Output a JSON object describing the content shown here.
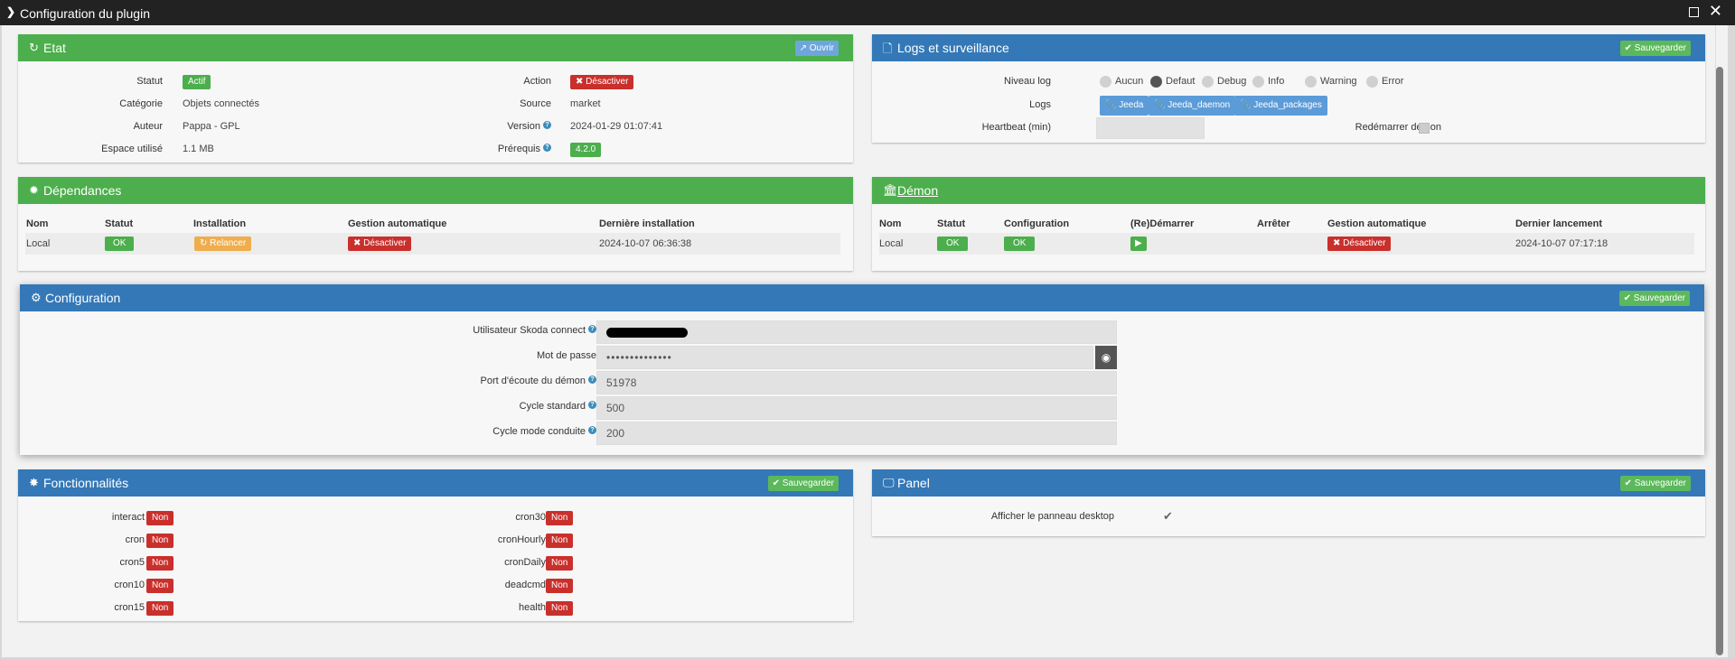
{
  "window": {
    "title": "Configuration du plugin"
  },
  "etat": {
    "title": "Etat",
    "open_btn": "Ouvrir",
    "statut_label": "Statut",
    "statut_value": "Actif",
    "categorie_label": "Catégorie",
    "categorie_value": "Objets connectés",
    "auteur_label": "Auteur",
    "auteur_value": "Pappa - GPL",
    "espace_label": "Espace utilisé",
    "espace_value": "1.1 MB",
    "action_label": "Action",
    "action_btn": "Désactiver",
    "source_label": "Source",
    "source_value": "market",
    "version_label": "Version",
    "version_value": "2024-01-29 01:07:41",
    "prerequis_label": "Prérequis",
    "prerequis_value": "4.2.0"
  },
  "logs": {
    "title": "Logs et surveillance",
    "save_btn": "Sauvegarder",
    "niveau_label": "Niveau log",
    "levels": [
      "Aucun",
      "Defaut",
      "Debug",
      "Info",
      "Warning",
      "Error"
    ],
    "logs_label": "Logs",
    "log_buttons": [
      "Jeeda",
      "Jeeda_daemon",
      "Jeeda_packages"
    ],
    "heartbeat_label": "Heartbeat (min)",
    "restart_label": "Redémarrer démon"
  },
  "deps": {
    "title": "Dépendances",
    "headers": [
      "Nom",
      "Statut",
      "Installation",
      "Gestion automatique",
      "Dernière installation"
    ],
    "nom": "Local",
    "statut": "OK",
    "relancer": "Relancer",
    "gestion": "Désactiver",
    "last": "2024-10-07 06:36:38"
  },
  "demon": {
    "title": "Démon",
    "headers": [
      "Nom",
      "Statut",
      "Configuration",
      "(Re)Démarrer",
      "Arrêter",
      "Gestion automatique",
      "Dernier lancement"
    ],
    "nom": "Local",
    "statut": "OK",
    "config": "OK",
    "gestion": "Désactiver",
    "last": "2024-10-07 07:17:18"
  },
  "config": {
    "title": "Configuration",
    "save_btn": "Sauvegarder",
    "user_label": "Utilisateur Skoda connect",
    "pass_label": "Mot de passe",
    "pass_value": "••••••••••••••",
    "port_label": "Port d'écoute du démon",
    "port_value": "51978",
    "cycle_label": "Cycle standard",
    "cycle_value": "500",
    "cyclemode_label": "Cycle mode conduite",
    "cyclemode_value": "200"
  },
  "fonc": {
    "title": "Fonctionnalités",
    "save_btn": "Sauvegarder",
    "left": [
      {
        "label": "interact",
        "value": "Non"
      },
      {
        "label": "cron",
        "value": "Non"
      },
      {
        "label": "cron5",
        "value": "Non"
      },
      {
        "label": "cron10",
        "value": "Non"
      },
      {
        "label": "cron15",
        "value": "Non"
      }
    ],
    "right": [
      {
        "label": "cron30",
        "value": "Non"
      },
      {
        "label": "cronHourly",
        "value": "Non"
      },
      {
        "label": "cronDaily",
        "value": "Non"
      },
      {
        "label": "deadcmd",
        "value": "Non"
      },
      {
        "label": "health",
        "value": "Non"
      }
    ]
  },
  "panelbox": {
    "title": "Panel",
    "save_btn": "Sauvegarder",
    "desktop_label": "Afficher le panneau desktop"
  }
}
